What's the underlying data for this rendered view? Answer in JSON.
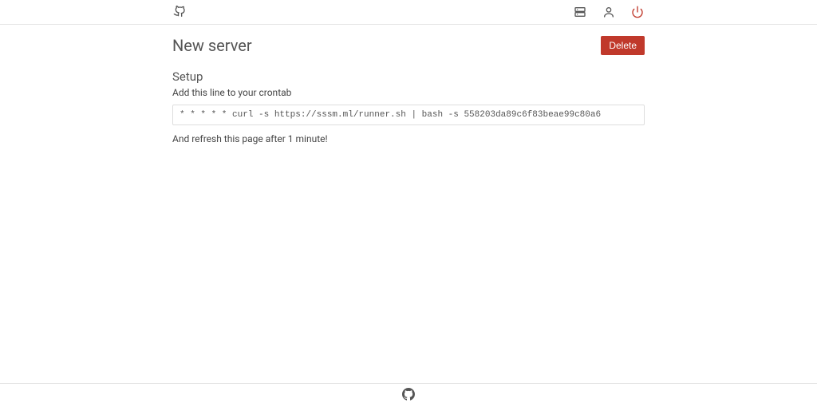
{
  "header": {
    "logo_name": "app-logo",
    "nav": {
      "servers": "Servers",
      "account": "Account",
      "logout": "Logout"
    }
  },
  "page": {
    "title": "New server",
    "delete_label": "Delete"
  },
  "setup": {
    "heading": "Setup",
    "instruction": "Add this line to your crontab",
    "command": "* * * * * curl -s https://sssm.ml/runner.sh | bash -s 558203da89c6f83beae99c80a6",
    "after": "And refresh this page after 1 minute!"
  },
  "footer": {
    "github": "GitHub"
  }
}
